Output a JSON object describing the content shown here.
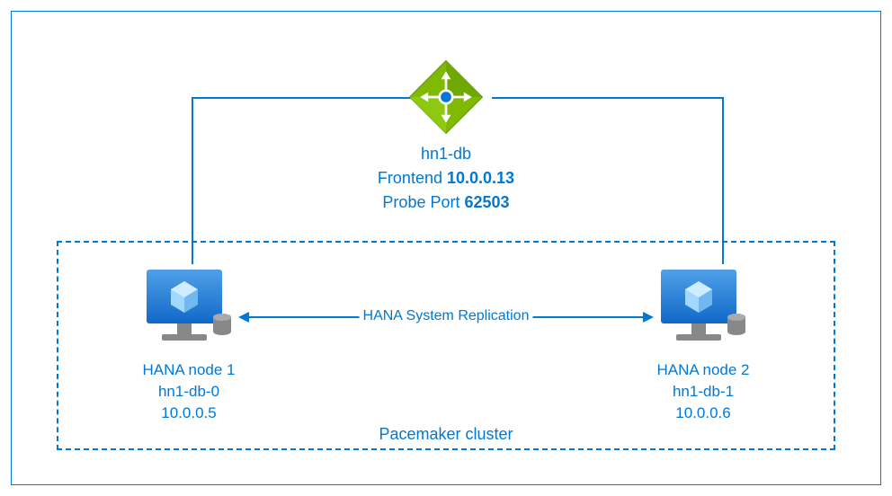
{
  "loadBalancer": {
    "name": "hn1-db",
    "frontendLabel": "Frontend",
    "frontendIp": "10.0.0.13",
    "probePortLabel": "Probe Port",
    "probePort": "62503"
  },
  "cluster": {
    "label": "Pacemaker cluster"
  },
  "replicationLabel": "HANA System Replication",
  "nodes": {
    "left": {
      "title": "HANA node 1",
      "hostname": "hn1-db-0",
      "ip": "10.0.0.5"
    },
    "right": {
      "title": "HANA node 2",
      "hostname": "hn1-db-1",
      "ip": "10.0.0.6"
    }
  }
}
